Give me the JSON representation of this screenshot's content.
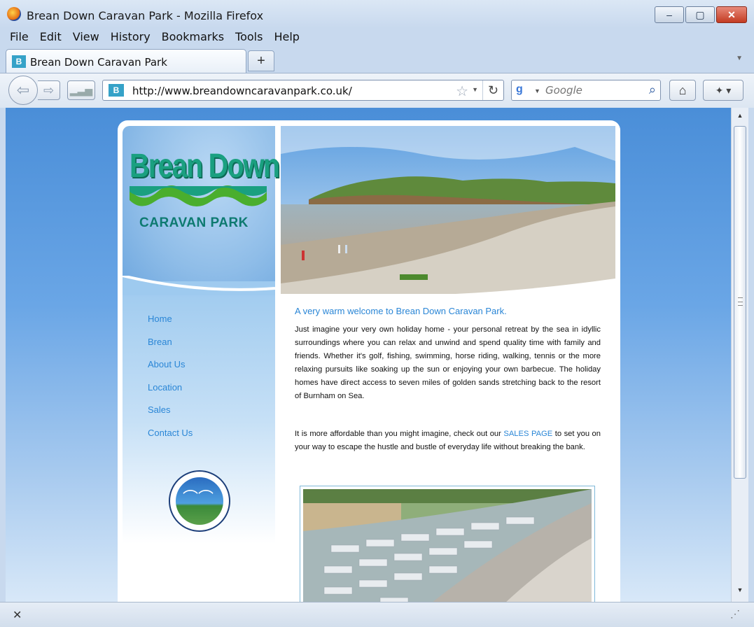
{
  "window": {
    "title": "Brean Down Caravan Park - Mozilla Firefox",
    "controls": {
      "minimize": "–",
      "maximize": "▢",
      "close": "✕"
    }
  },
  "menu": [
    "File",
    "Edit",
    "View",
    "History",
    "Bookmarks",
    "Tools",
    "Help"
  ],
  "tab": {
    "label": "Brean Down Caravan Park",
    "favicon": "B",
    "new_tab": "+"
  },
  "toolbar": {
    "url": "http://www.breandowncaravanpark.co.uk/",
    "search_placeholder": "Google",
    "icons": {
      "back": "back-arrow-icon",
      "forward": "forward-arrow-icon",
      "reload": "reload-icon",
      "home": "home-icon",
      "star": "bookmark-star-icon"
    }
  },
  "site": {
    "logo_title": "Brean Down",
    "logo_subtitle": "CARAVAN PARK",
    "nav": [
      "Home",
      "Brean",
      "About Us",
      "Location",
      "Sales",
      "Contact Us"
    ],
    "welcome": "A very warm welcome to Brean Down Caravan Park.",
    "para1": "Just imagine your very own holiday home - your personal retreat by the sea in idyllic surroundings where you can relax and unwind and spend quality time with family and friends. Whether it's golf, fishing, swimming, horse riding, walking, tennis or the more relaxing pursuits like soaking up the sun or enjoying your own barbecue. The holiday homes have direct access to seven miles of golden sands stretching back to the resort of Burnham on Sea.",
    "para2_before": "It is more affordable than you might imagine, check out our ",
    "para2_link": "SALES PAGE",
    "para2_after": " to set you on your way to escape the hustle and bustle of everyday life without breaking the bank.",
    "accent_color": "#2a86d6"
  }
}
